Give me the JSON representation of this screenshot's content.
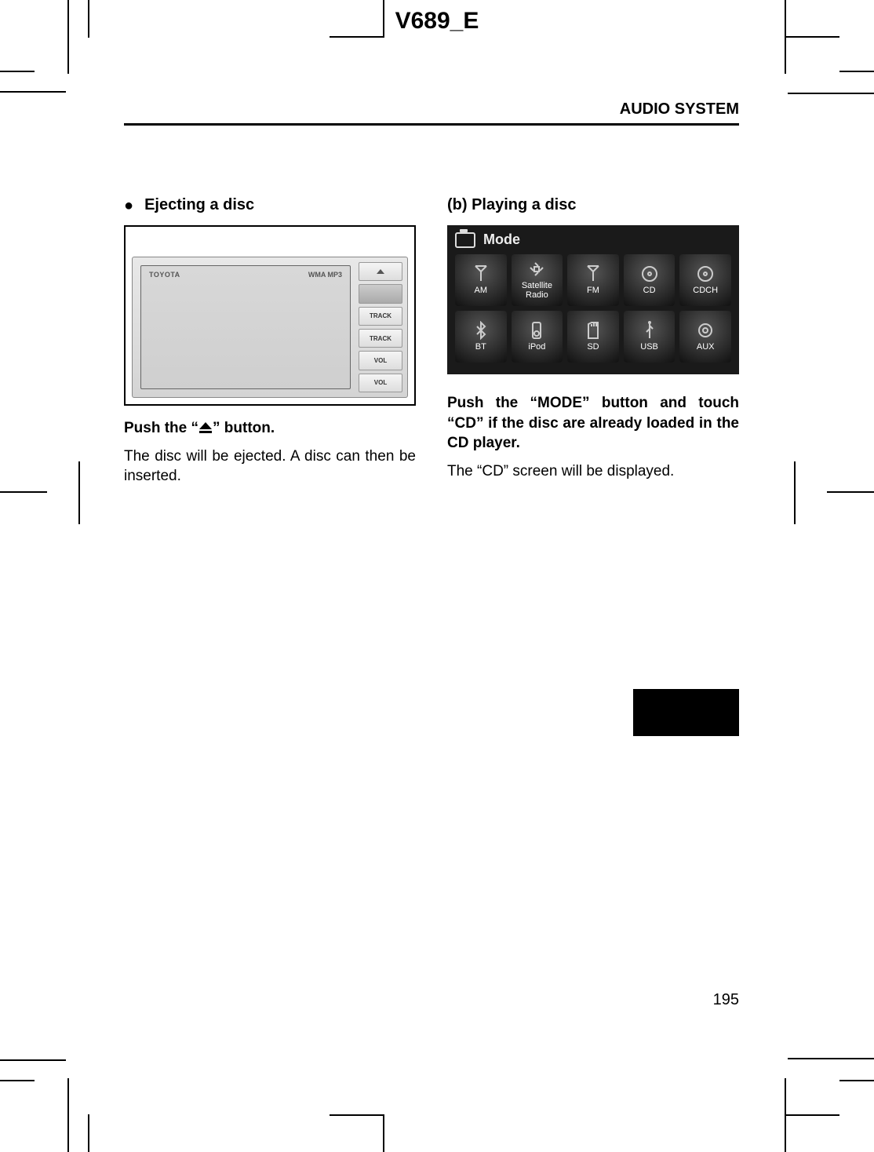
{
  "doc_header": "V689_E",
  "section_title": "AUDIO SYSTEM",
  "page_number": "195",
  "left": {
    "heading": "Ejecting a disc",
    "unit": {
      "brand": "TOYOTA",
      "formats": "WMA MP3",
      "buttons": {
        "eject": "",
        "cd": "",
        "track_up": "TRACK",
        "track_down": "TRACK",
        "vol_up": "VOL",
        "vol_down": "VOL"
      }
    },
    "instruction_prefix": "Push the “",
    "instruction_suffix": "” button.",
    "body": "The disc will be ejected. A disc can then be inserted."
  },
  "right": {
    "heading": "(b)  Playing a disc",
    "mode_label": "Mode",
    "modes": {
      "am": "AM",
      "sat": "Satellite\nRadio",
      "fm": "FM",
      "cd": "CD",
      "cdch": "CDCH",
      "bt": "BT",
      "ipod": "iPod",
      "sd": "SD",
      "usb": "USB",
      "aux": "AUX"
    },
    "instruction": "Push the “MODE” button and touch “CD” if the disc are already loaded in the CD player.",
    "body": "The “CD” screen will be displayed."
  }
}
